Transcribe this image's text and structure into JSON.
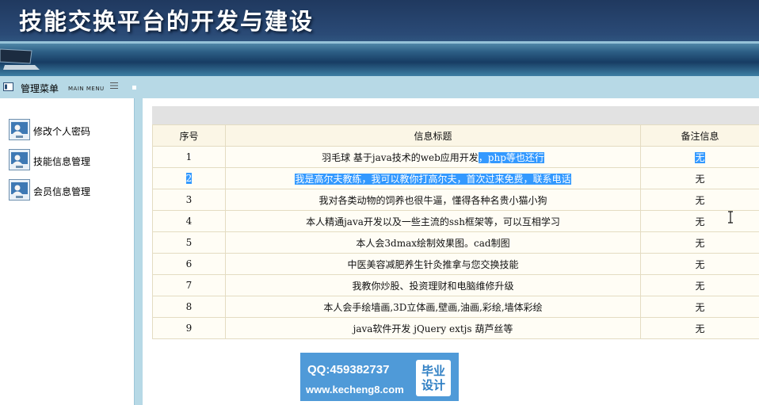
{
  "header": {
    "title": "技能交换平台的开发与建设"
  },
  "menubar": {
    "title": "管理菜单",
    "subtitle": "MAIN MENU"
  },
  "sidebar": {
    "items": [
      {
        "label": "修改个人密码"
      },
      {
        "label": "技能信息管理"
      },
      {
        "label": "会员信息管理"
      }
    ]
  },
  "table": {
    "headers": [
      "序号",
      "信息标题",
      "备注信息"
    ],
    "rows": [
      {
        "no": "1",
        "title_a": "羽毛球 基于java技术的web应用开发",
        "title_b": "，php等也还行",
        "note": "无"
      },
      {
        "no": "2",
        "title": "我是高尔夫教练，我可以教你打高尔夫，首次过来免费，联系电话",
        "note": "无"
      },
      {
        "no": "3",
        "title": "我对各类动物的饲养也很牛逼，懂得各种名贵小猫小狗",
        "note": "无"
      },
      {
        "no": "4",
        "title": "本人精通java开发以及一些主流的ssh框架等，可以互相学习",
        "note": "无"
      },
      {
        "no": "5",
        "title": "本人会3dmax绘制效果图。cad制图",
        "note": "无"
      },
      {
        "no": "6",
        "title": "中医美容减肥养生针灸推拿与您交换技能",
        "note": "无"
      },
      {
        "no": "7",
        "title": "我教你炒股、投资理财和电脑维修升级",
        "note": "无"
      },
      {
        "no": "8",
        "title": "本人会手绘墙画,3D立体画,壁画,油画,彩绘,墙体彩绘",
        "note": "无"
      },
      {
        "no": "9",
        "title": "java软件开发 jQuery extjs 葫芦丝等",
        "note": "无"
      }
    ]
  },
  "badge": {
    "qq": "QQ:459382737",
    "site": "www.kecheng8.com",
    "tag": "毕业设计"
  },
  "colors": {
    "selection": "#3399ff",
    "header_dark": "#20395f",
    "menubar": "#b7d9e6"
  }
}
